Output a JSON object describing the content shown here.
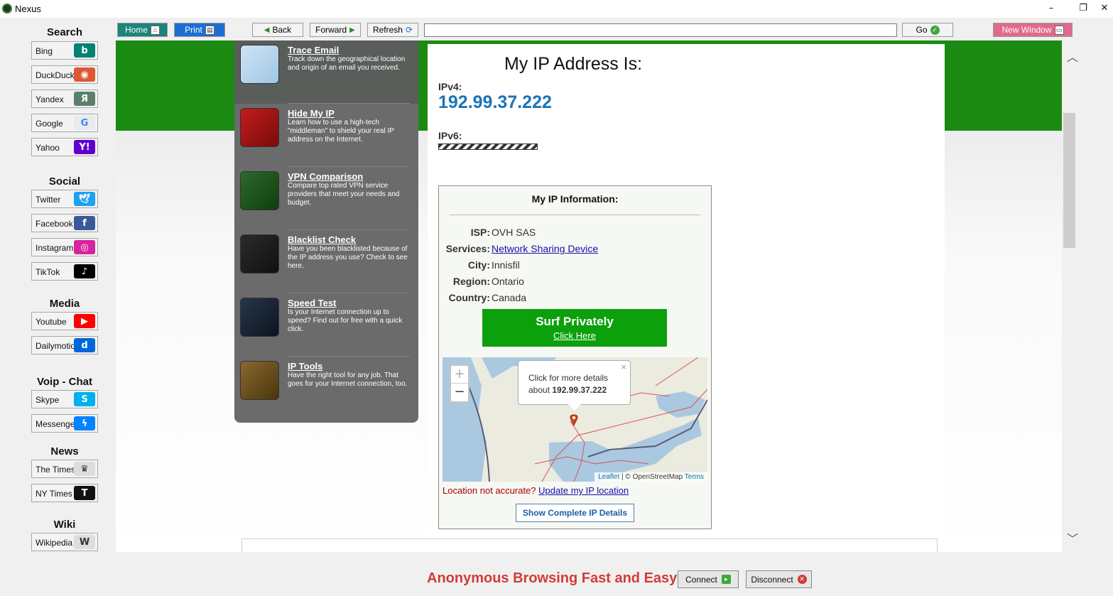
{
  "window": {
    "title": "Nexus",
    "minimize": "–",
    "maximize": "❐",
    "close": "✕"
  },
  "sidebar": [
    {
      "title": "Search",
      "items": [
        {
          "label": "Bing",
          "icon": "bing-icon",
          "glyph": "b",
          "color": "#008373"
        },
        {
          "label": "DuckDuckGo",
          "icon": "duckduckgo-icon",
          "glyph": "◉",
          "color": "#de5833"
        },
        {
          "label": "Yandex",
          "icon": "yandex-icon",
          "glyph": "Я",
          "color": "#5a7f6b"
        },
        {
          "label": "Google",
          "icon": "google-icon",
          "glyph": "G",
          "color": "#e8eaed",
          "glyphColor": "#4285f4"
        },
        {
          "label": "Yahoo",
          "icon": "yahoo-icon",
          "glyph": "Y!",
          "color": "#5f01d1"
        }
      ]
    },
    {
      "title": "Social",
      "items": [
        {
          "label": "Twitter",
          "icon": "twitter-icon",
          "glyph": "🕊",
          "color": "#1da1f2"
        },
        {
          "label": "Facebook",
          "icon": "facebook-icon",
          "glyph": "f",
          "color": "#3b5998"
        },
        {
          "label": "Instagram",
          "icon": "instagram-icon",
          "glyph": "◎",
          "color": "#d6249f"
        },
        {
          "label": "TikTok",
          "icon": "tiktok-icon",
          "glyph": "♪",
          "color": "#000000"
        }
      ]
    },
    {
      "title": "Media",
      "items": [
        {
          "label": "Youtube",
          "icon": "youtube-icon",
          "glyph": "▶",
          "color": "#ff0000"
        },
        {
          "label": "Dailymotion",
          "icon": "dailymotion-icon",
          "glyph": "d",
          "color": "#0066dc"
        }
      ]
    },
    {
      "title": "Voip - Chat",
      "items": [
        {
          "label": "Skype",
          "icon": "skype-icon",
          "glyph": "S",
          "color": "#00aff0"
        },
        {
          "label": "Messenger",
          "icon": "messenger-icon",
          "glyph": "ϟ",
          "color": "#0084ff"
        }
      ]
    },
    {
      "title": "News",
      "items": [
        {
          "label": "The Times",
          "icon": "the-times-crest-icon",
          "glyph": "♛",
          "color": "#dddddd",
          "glyphColor": "#333333"
        },
        {
          "label": "NY Times",
          "icon": "nytimes-icon",
          "glyph": "T",
          "color": "#111111"
        }
      ]
    },
    {
      "title": "Wiki",
      "items": [
        {
          "label": "Wikipedia",
          "icon": "wikipedia-globe-icon",
          "glyph": "W",
          "color": "#dddddd",
          "glyphColor": "#333333"
        }
      ]
    }
  ],
  "toolbar": {
    "home": "Home",
    "print": "Print",
    "back": "Back",
    "forward": "Forward",
    "refresh": "Refresh",
    "address": "",
    "go": "Go",
    "new_window": "New Window"
  },
  "menu": [
    {
      "title": "Trace Email",
      "desc": "Track down the geographical location and origin of an email you received.",
      "icon": "trace-email-map-icon",
      "bg": "linear-gradient(135deg,#cfe3f3,#9fc6e6)"
    },
    {
      "title": "Hide My IP",
      "desc": "Learn how to use a high-tech \"middleman\" to shield your real IP address on the Internet.",
      "icon": "hide-my-ip-icon",
      "bg": "linear-gradient(135deg,#c21d1d,#7a0b0b)"
    },
    {
      "title": "VPN Comparison",
      "desc": "Compare top rated VPN service providers that meet your needs and budget.",
      "icon": "vpn-comparison-icon",
      "bg": "linear-gradient(135deg,#2c6a2c,#0f3d0f)"
    },
    {
      "title": "Blacklist Check",
      "desc": "Have you been blacklisted because of the IP address you use? Check to see here.",
      "icon": "blacklist-check-icon",
      "bg": "linear-gradient(135deg,#2a2a2a,#111111)"
    },
    {
      "title": "Speed Test",
      "desc": "Is your Internet connection up to speed? Find out for free with a quick click.",
      "icon": "speed-test-gauge-icon",
      "bg": "linear-gradient(135deg,#27364a,#0c1420)"
    },
    {
      "title": "IP Tools",
      "desc": "Have the right tool for any job. That goes for your Internet connection, too.",
      "icon": "ip-tools-icon",
      "bg": "linear-gradient(135deg,#8a6a2c,#4a3510)"
    }
  ],
  "main": {
    "heading": "My IP Address Is:",
    "ipv4_label": "IPv4:",
    "ipv4": "192.99.37.222",
    "ipv6_label": "IPv6:",
    "info_title": "My IP Information:",
    "rows": [
      {
        "key": "ISP:",
        "value": "OVH SAS"
      },
      {
        "key": "Services:",
        "value": "Network Sharing Device"
      },
      {
        "key": "City:",
        "value": "Innisfil"
      },
      {
        "key": "Region:",
        "value": "Ontario"
      },
      {
        "key": "Country:",
        "value": "Canada"
      }
    ],
    "surf_title": "Surf Privately",
    "surf_link": "Click Here",
    "map": {
      "zoom_in": "+",
      "zoom_out": "−",
      "popup_line1": "Click for more details about",
      "popup_ip": "192.99.37.222",
      "popup_close": "×",
      "leaflet": "Leaflet",
      "sep": " | © OpenStreetMap ",
      "terms": "Terms"
    },
    "loc_question": "Location not accurate? ",
    "loc_link": "Update my IP location",
    "show_details": "Show Complete IP Details"
  },
  "statusbar": {
    "tagline": "Anonymous Browsing Fast and Easy",
    "connect": "Connect",
    "disconnect": "Disconnect"
  },
  "colors": {
    "accent_green": "#1b8a13",
    "ip_blue": "#1b74b7",
    "tagline_red": "#d13b3b"
  }
}
